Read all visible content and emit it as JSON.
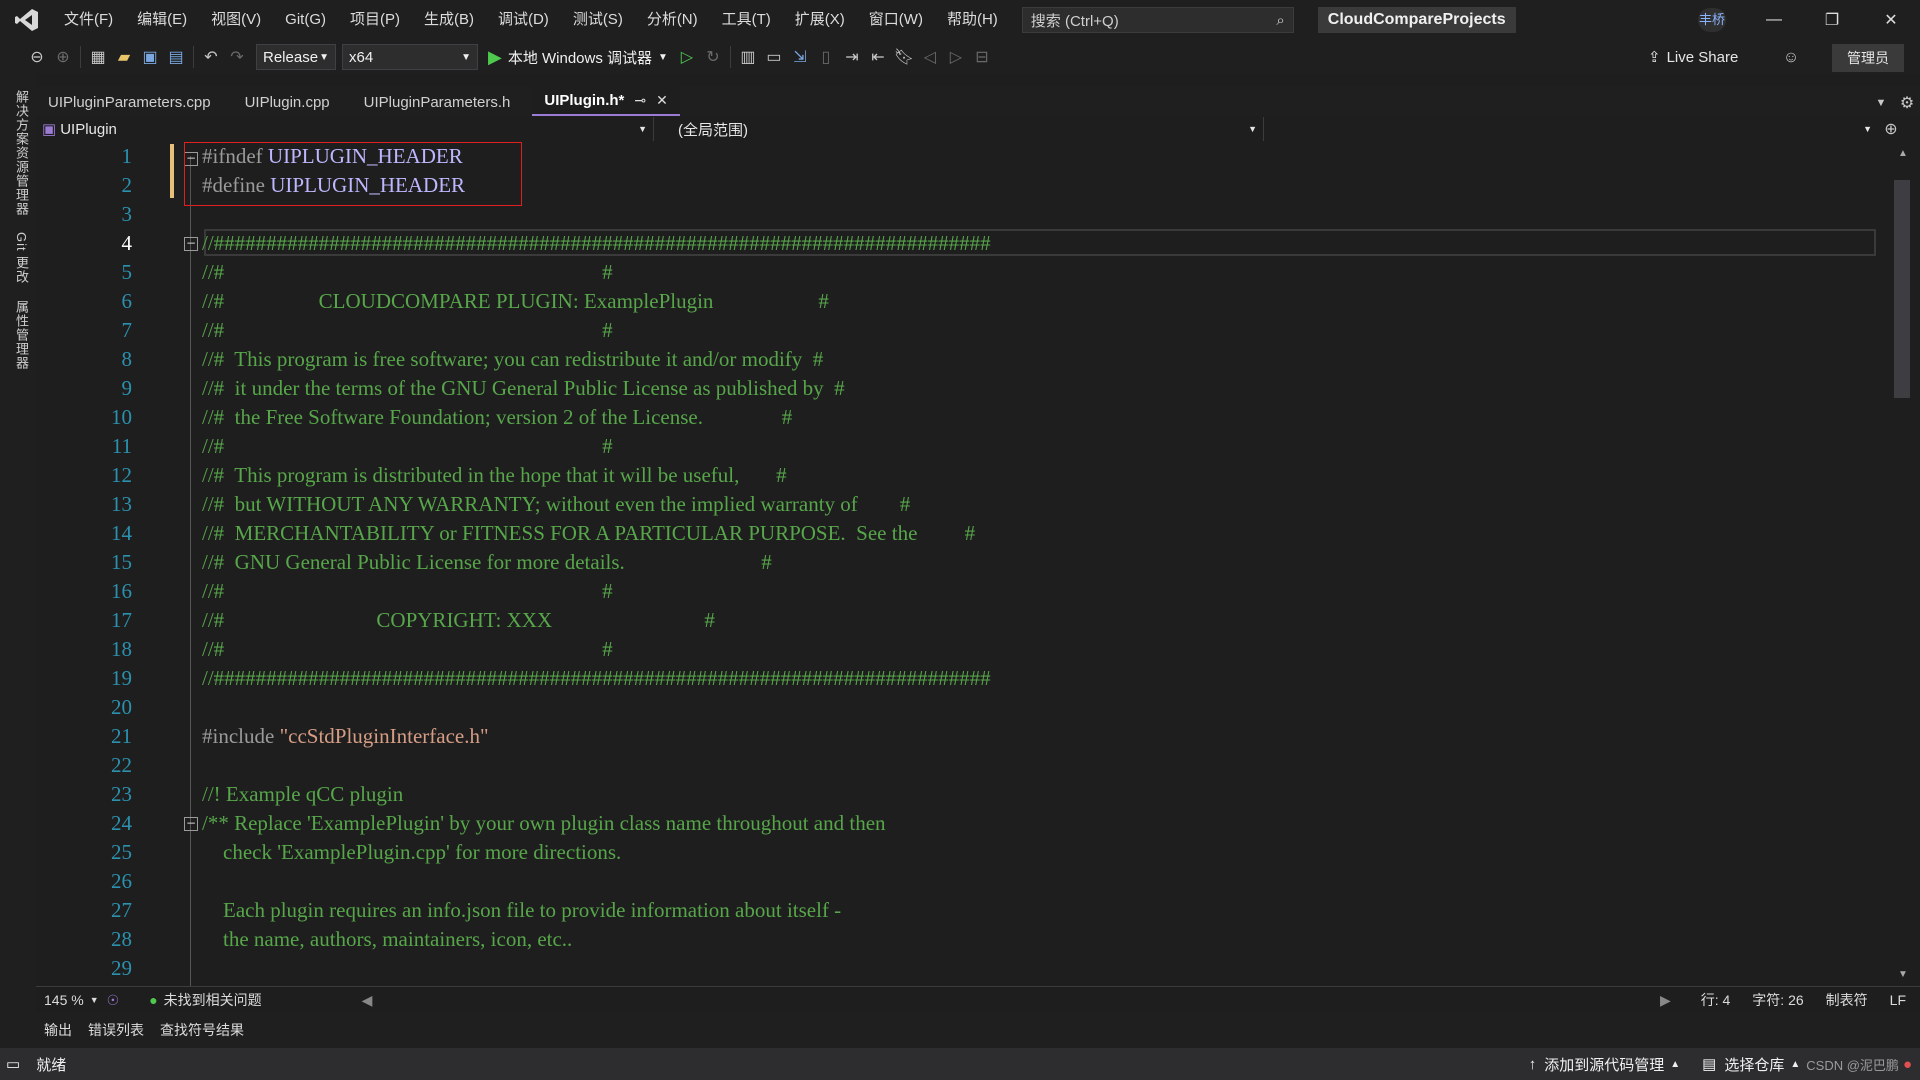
{
  "menu": [
    "文件(F)",
    "编辑(E)",
    "视图(V)",
    "Git(G)",
    "项目(P)",
    "生成(B)",
    "调试(D)",
    "测试(S)",
    "分析(N)",
    "工具(T)",
    "扩展(X)",
    "窗口(W)",
    "帮助(H)"
  ],
  "search": {
    "placeholder": "搜索 (Ctrl+Q)"
  },
  "project_title": "CloudCompareProjects",
  "user": {
    "avatar_text": "丰桥"
  },
  "toolbar": {
    "config": "Release",
    "platform": "x64",
    "run_label": "本地 Windows 调试器",
    "live_share": "Live Share",
    "admin": "管理员"
  },
  "sidebar": [
    "解决方案资源管理器",
    "Git 更改",
    "属性管理器"
  ],
  "tabs": [
    {
      "label": "UIPluginParameters.cpp"
    },
    {
      "label": "UIPlugin.cpp"
    },
    {
      "label": "UIPluginParameters.h"
    },
    {
      "label": "UIPlugin.h*"
    }
  ],
  "nav": {
    "project": "UIPlugin",
    "scope": "(全局范围)"
  },
  "code_lines": [
    {
      "n": "1",
      "text": "#ifndef UIPLUGIN_HEADER",
      "kind": "directive"
    },
    {
      "n": "2",
      "text": "#define UIPLUGIN_HEADER",
      "kind": "directive"
    },
    {
      "n": "3",
      "text": "",
      "kind": "plain"
    },
    {
      "n": "4",
      "text": "//##########################################################################",
      "kind": "comment"
    },
    {
      "n": "5",
      "text": "//#                                                                        #",
      "kind": "comment"
    },
    {
      "n": "6",
      "text": "//#                  CLOUDCOMPARE PLUGIN: ExamplePlugin                    #",
      "kind": "comment"
    },
    {
      "n": "7",
      "text": "//#                                                                        #",
      "kind": "comment"
    },
    {
      "n": "8",
      "text": "//#  This program is free software; you can redistribute it and/or modify  #",
      "kind": "comment"
    },
    {
      "n": "9",
      "text": "//#  it under the terms of the GNU General Public License as published by  #",
      "kind": "comment"
    },
    {
      "n": "10",
      "text": "//#  the Free Software Foundation; version 2 of the License.               #",
      "kind": "comment"
    },
    {
      "n": "11",
      "text": "//#                                                                        #",
      "kind": "comment"
    },
    {
      "n": "12",
      "text": "//#  This program is distributed in the hope that it will be useful,       #",
      "kind": "comment"
    },
    {
      "n": "13",
      "text": "//#  but WITHOUT ANY WARRANTY; without even the implied warranty of        #",
      "kind": "comment"
    },
    {
      "n": "14",
      "text": "//#  MERCHANTABILITY or FITNESS FOR A PARTICULAR PURPOSE.  See the         #",
      "kind": "comment"
    },
    {
      "n": "15",
      "text": "//#  GNU General Public License for more details.                          #",
      "kind": "comment"
    },
    {
      "n": "16",
      "text": "//#                                                                        #",
      "kind": "comment"
    },
    {
      "n": "17",
      "text": "//#                             COPYRIGHT: XXX                             #",
      "kind": "comment"
    },
    {
      "n": "18",
      "text": "//#                                                                        #",
      "kind": "comment"
    },
    {
      "n": "19",
      "text": "//##########################################################################",
      "kind": "comment"
    },
    {
      "n": "20",
      "text": "",
      "kind": "plain"
    },
    {
      "n": "21",
      "text": "#include \"ccStdPluginInterface.h\"",
      "kind": "include"
    },
    {
      "n": "22",
      "text": "",
      "kind": "plain"
    },
    {
      "n": "23",
      "text": "//! Example qCC plugin",
      "kind": "comment"
    },
    {
      "n": "24",
      "text": "/** Replace 'ExamplePlugin' by your own plugin class name throughout and then",
      "kind": "comment"
    },
    {
      "n": "25",
      "text": "    check 'ExamplePlugin.cpp' for more directions.",
      "kind": "comment"
    },
    {
      "n": "26",
      "text": "",
      "kind": "plain"
    },
    {
      "n": "27",
      "text": "    Each plugin requires an info.json file to provide information about itself -",
      "kind": "comment"
    },
    {
      "n": "28",
      "text": "    the name, authors, maintainers, icon, etc..",
      "kind": "comment"
    },
    {
      "n": "29",
      "text": "",
      "kind": "plain"
    }
  ],
  "editor_status": {
    "zoom": "145 %",
    "issues": "未找到相关问题",
    "line": "行: 4",
    "char": "字符: 26",
    "tab_mode": "制表符",
    "eol": "LF"
  },
  "bottom_tabs": [
    "输出",
    "错误列表",
    "查找符号结果"
  ],
  "status": {
    "ready": "就绪",
    "source_control": "添加到源代码管理",
    "repo": "选择仓库",
    "watermark": "CSDN @泥巴鹏"
  },
  "colors": {
    "accent": "#9b7bd4",
    "comment": "#57a64a",
    "line_number": "#2b91af",
    "highlight_box": "#e02020"
  }
}
